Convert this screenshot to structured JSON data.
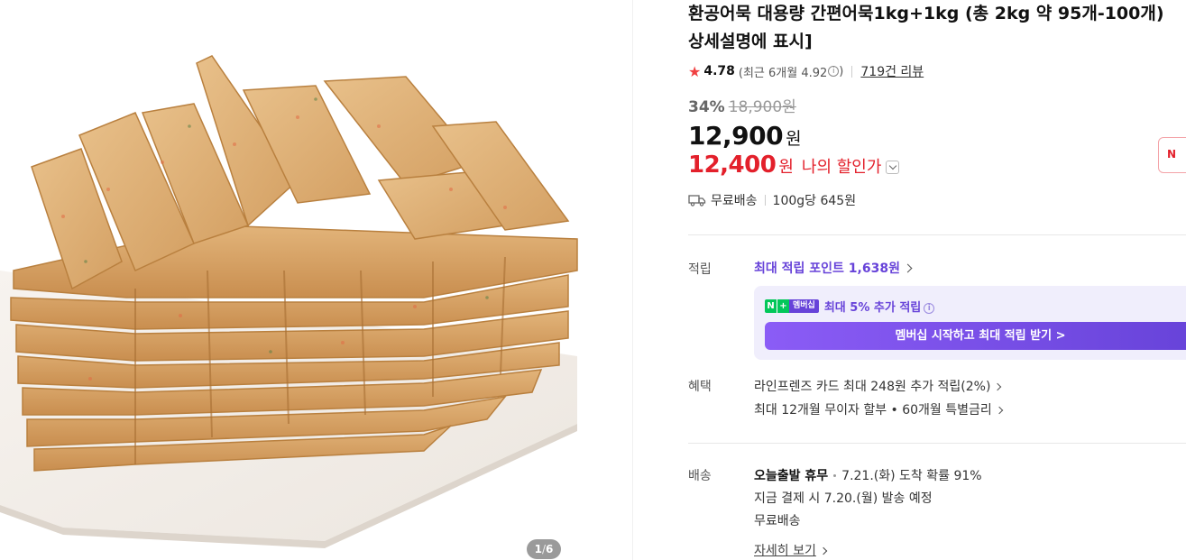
{
  "product": {
    "title_line1": "환공어묵 대용량 간편어묵1kg+1kg (총 2kg 약 95개-100개)",
    "title_line2": "상세설명에 표시]",
    "rating": "4.78",
    "recent_rating": "(최근 6개월 4.92",
    "recent_rating_close": ")",
    "info_glyph": "i",
    "reviews": "719건 리뷰",
    "discount_rate": "34%",
    "original_price": "18,900원",
    "price": "12,900",
    "price_unit": "원",
    "my_price": "12,400",
    "my_price_unit": "원",
    "my_price_label": "나의 할인가",
    "shipping": "무료배송",
    "unit_price": "100g당 645원"
  },
  "image": {
    "pager_current": "1",
    "pager_sep": "/",
    "pager_total": "6"
  },
  "points": {
    "label": "적립",
    "link_text": "최대 적립 포인트",
    "amount": "1,638원",
    "badge_n": "N",
    "badge_plus": "+",
    "badge_member": "멤버십",
    "member_text": "최대 5% 추가 적립",
    "member_button": "멤버십 시작하고 최대 적립 받기 >"
  },
  "benefits": {
    "label": "혜택",
    "line1": "라인프렌즈 카드 최대 248원 추가 적립(2%)",
    "line2": "최대 12개월 무이자 할부 • 60개월 특별금리"
  },
  "delivery": {
    "label": "배송",
    "today_bold": "오늘출발 휴무",
    "arrival": "7.21.(화) 도착 확률 91%",
    "dispatch": "지금 결제 시 7.20.(월) 발송 예정",
    "free": "무료배송",
    "detail_link": "자세히 보기"
  },
  "side_badge": "N",
  "colors": {
    "accent_red": "#e3202b",
    "accent_purple": "#6743d9",
    "star": "#f04142"
  }
}
